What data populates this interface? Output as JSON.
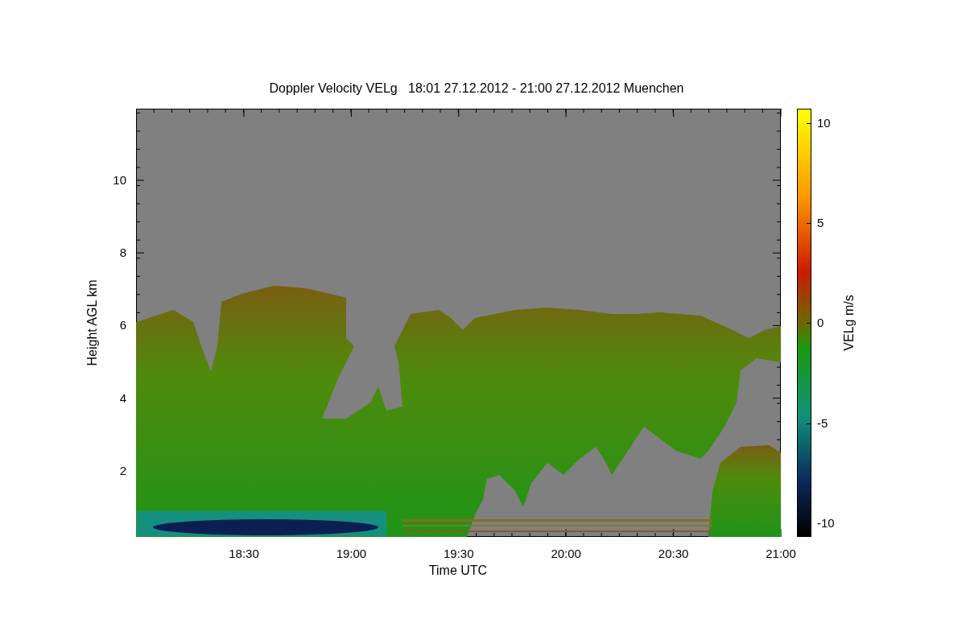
{
  "title": "Doppler Velocity VELg   18:01 27.12.2012 - 21:00 27.12.2012 Muenchen",
  "xlabel": "Time UTC",
  "ylabel": "Height AGL km",
  "xticks": [
    "18:30",
    "19:00",
    "19:30",
    "20:00",
    "20:30",
    "21:00"
  ],
  "yticks": [
    "10",
    "8",
    "6",
    "4",
    "2"
  ],
  "colorbar": {
    "label": "VELg m/s",
    "ticks": [
      "10",
      "5",
      "0",
      "-5",
      "-10"
    ]
  }
}
